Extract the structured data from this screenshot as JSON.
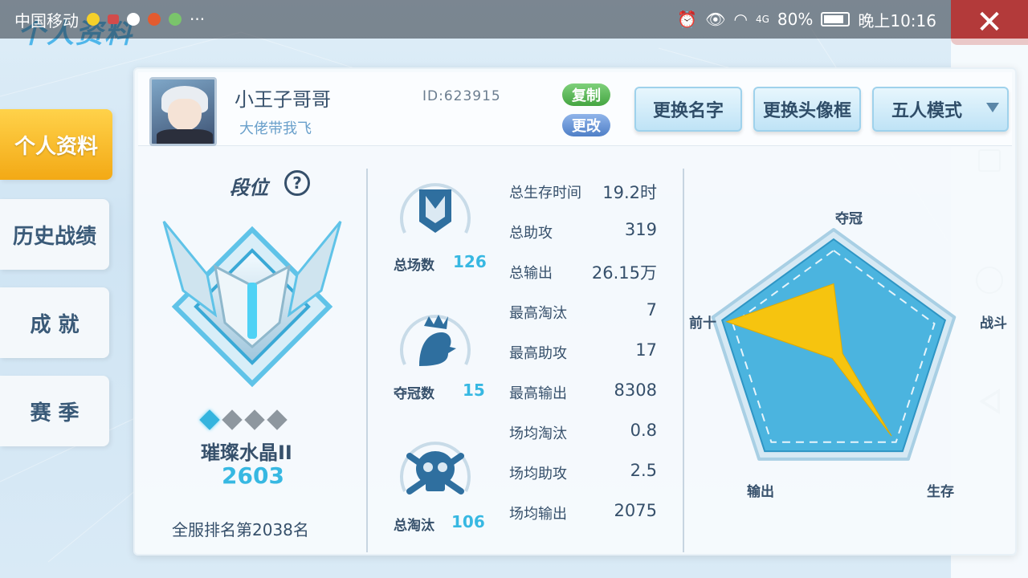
{
  "status_bar": {
    "carrier": "中国移动",
    "more": "···",
    "signal": "4G",
    "battery": "80%",
    "time": "晚上10:16"
  },
  "page": {
    "title": "个人资料"
  },
  "nav": {
    "tabs": [
      {
        "label": "个人资料",
        "active": true
      },
      {
        "label": "历史战绩",
        "active": false
      },
      {
        "label": "成 就",
        "active": false
      },
      {
        "label": "赛 季",
        "active": false
      }
    ]
  },
  "profile": {
    "name": "小王子哥哥",
    "motto": "大佬带我飞",
    "id_text": "ID:623915",
    "copy_label": "复制",
    "edit_label": "更改",
    "rename_label": "更换名字",
    "frame_label": "更换头像框",
    "mode_label": "五人模式"
  },
  "rank": {
    "title": "段位",
    "help": "?",
    "stars_lit": 1,
    "stars_total": 4,
    "name": "璀璨水晶II",
    "score": "2603",
    "position": "全服排名第2038名"
  },
  "summary": {
    "matches_label": "总场数",
    "matches_value": "126",
    "wins_label": "夺冠数",
    "wins_value": "15",
    "kills_label": "总淘汰",
    "kills_value": "106"
  },
  "stats": [
    {
      "label": "总生存时间",
      "value": "19.2时"
    },
    {
      "label": "总助攻",
      "value": "319"
    },
    {
      "label": "总输出",
      "value": "26.15万"
    },
    {
      "label": "最高淘汰",
      "value": "7"
    },
    {
      "label": "最高助攻",
      "value": "17"
    },
    {
      "label": "最高输出",
      "value": "8308"
    },
    {
      "label": "场均淘汰",
      "value": "0.8"
    },
    {
      "label": "场均助攻",
      "value": "2.5"
    },
    {
      "label": "场均输出",
      "value": "2075"
    }
  ],
  "radar": {
    "axes": [
      "夺冠",
      "战斗",
      "生存",
      "输出",
      "前十"
    ],
    "values": [
      0.62,
      0.08,
      0.84,
      0.02,
      0.96
    ],
    "fill_color": "#f6c40f",
    "base_color": "#4bb4df"
  },
  "colors": {
    "accent": "#37b8e2",
    "tab_active": "#f3a915",
    "close": "#b33a3a"
  }
}
